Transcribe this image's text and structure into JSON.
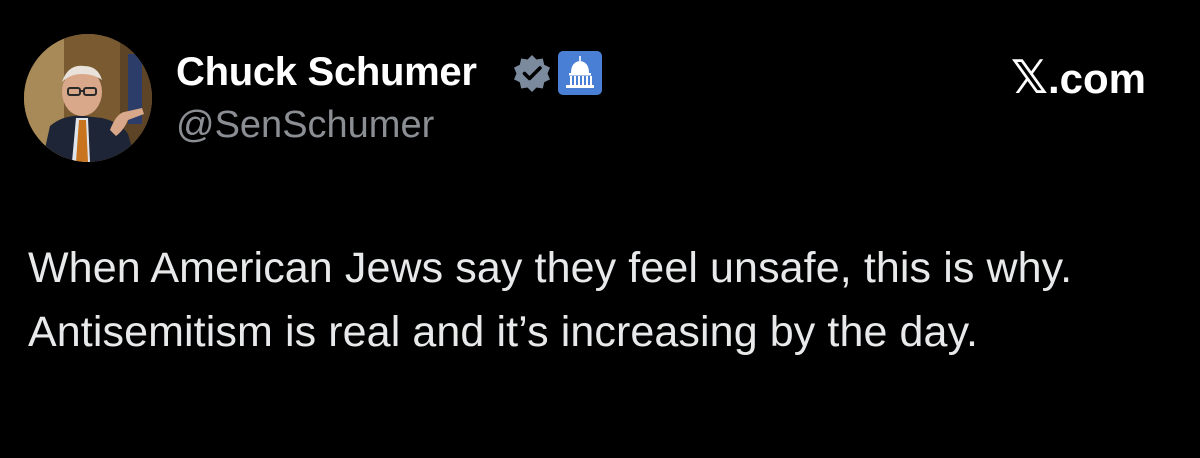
{
  "tweet": {
    "author": {
      "name": "Chuck Schumer",
      "handle": "@SenSchumer",
      "avatar_icon": "person-portrait-avatar",
      "verified_icon": "verified-badge-icon",
      "affiliation_icon": "capitol-building-icon",
      "verified_color": "#7c8a9e",
      "affiliation_color": "#4a7fd6"
    },
    "site": {
      "x_mark": "𝕏",
      "domain": ".com"
    },
    "text": "When American Jews say they feel unsafe, this is why. Antisemitism is real and it’s increasing by the day."
  },
  "colors": {
    "background": "#000000",
    "name": "#ffffff",
    "handle": "#8b8f94",
    "body": "#e7e9ea"
  }
}
